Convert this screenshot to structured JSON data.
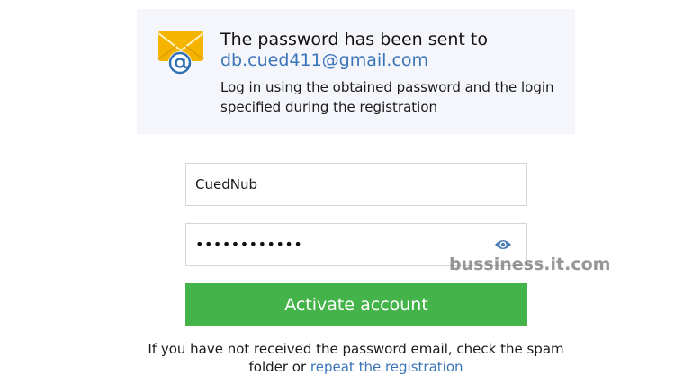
{
  "notice": {
    "title": "The password has been sent to",
    "email": "db.cued411@gmail.com",
    "text": "Log in using the obtained password and the login specified during the registration",
    "icon": "envelope-at-icon"
  },
  "form": {
    "login_value": "CuedNub",
    "password_masked": "••••••••••••",
    "eye_icon": "eye-icon",
    "submit_label": "Activate account"
  },
  "help": {
    "text_before": "If you have not received the password email, check the spam folder or ",
    "link": "repeat the registration"
  },
  "watermark": "bussiness.it.com",
  "colors": {
    "accent_green": "#44b349",
    "link_blue": "#3b74b8",
    "notice_bg": "#f4f6fb"
  }
}
